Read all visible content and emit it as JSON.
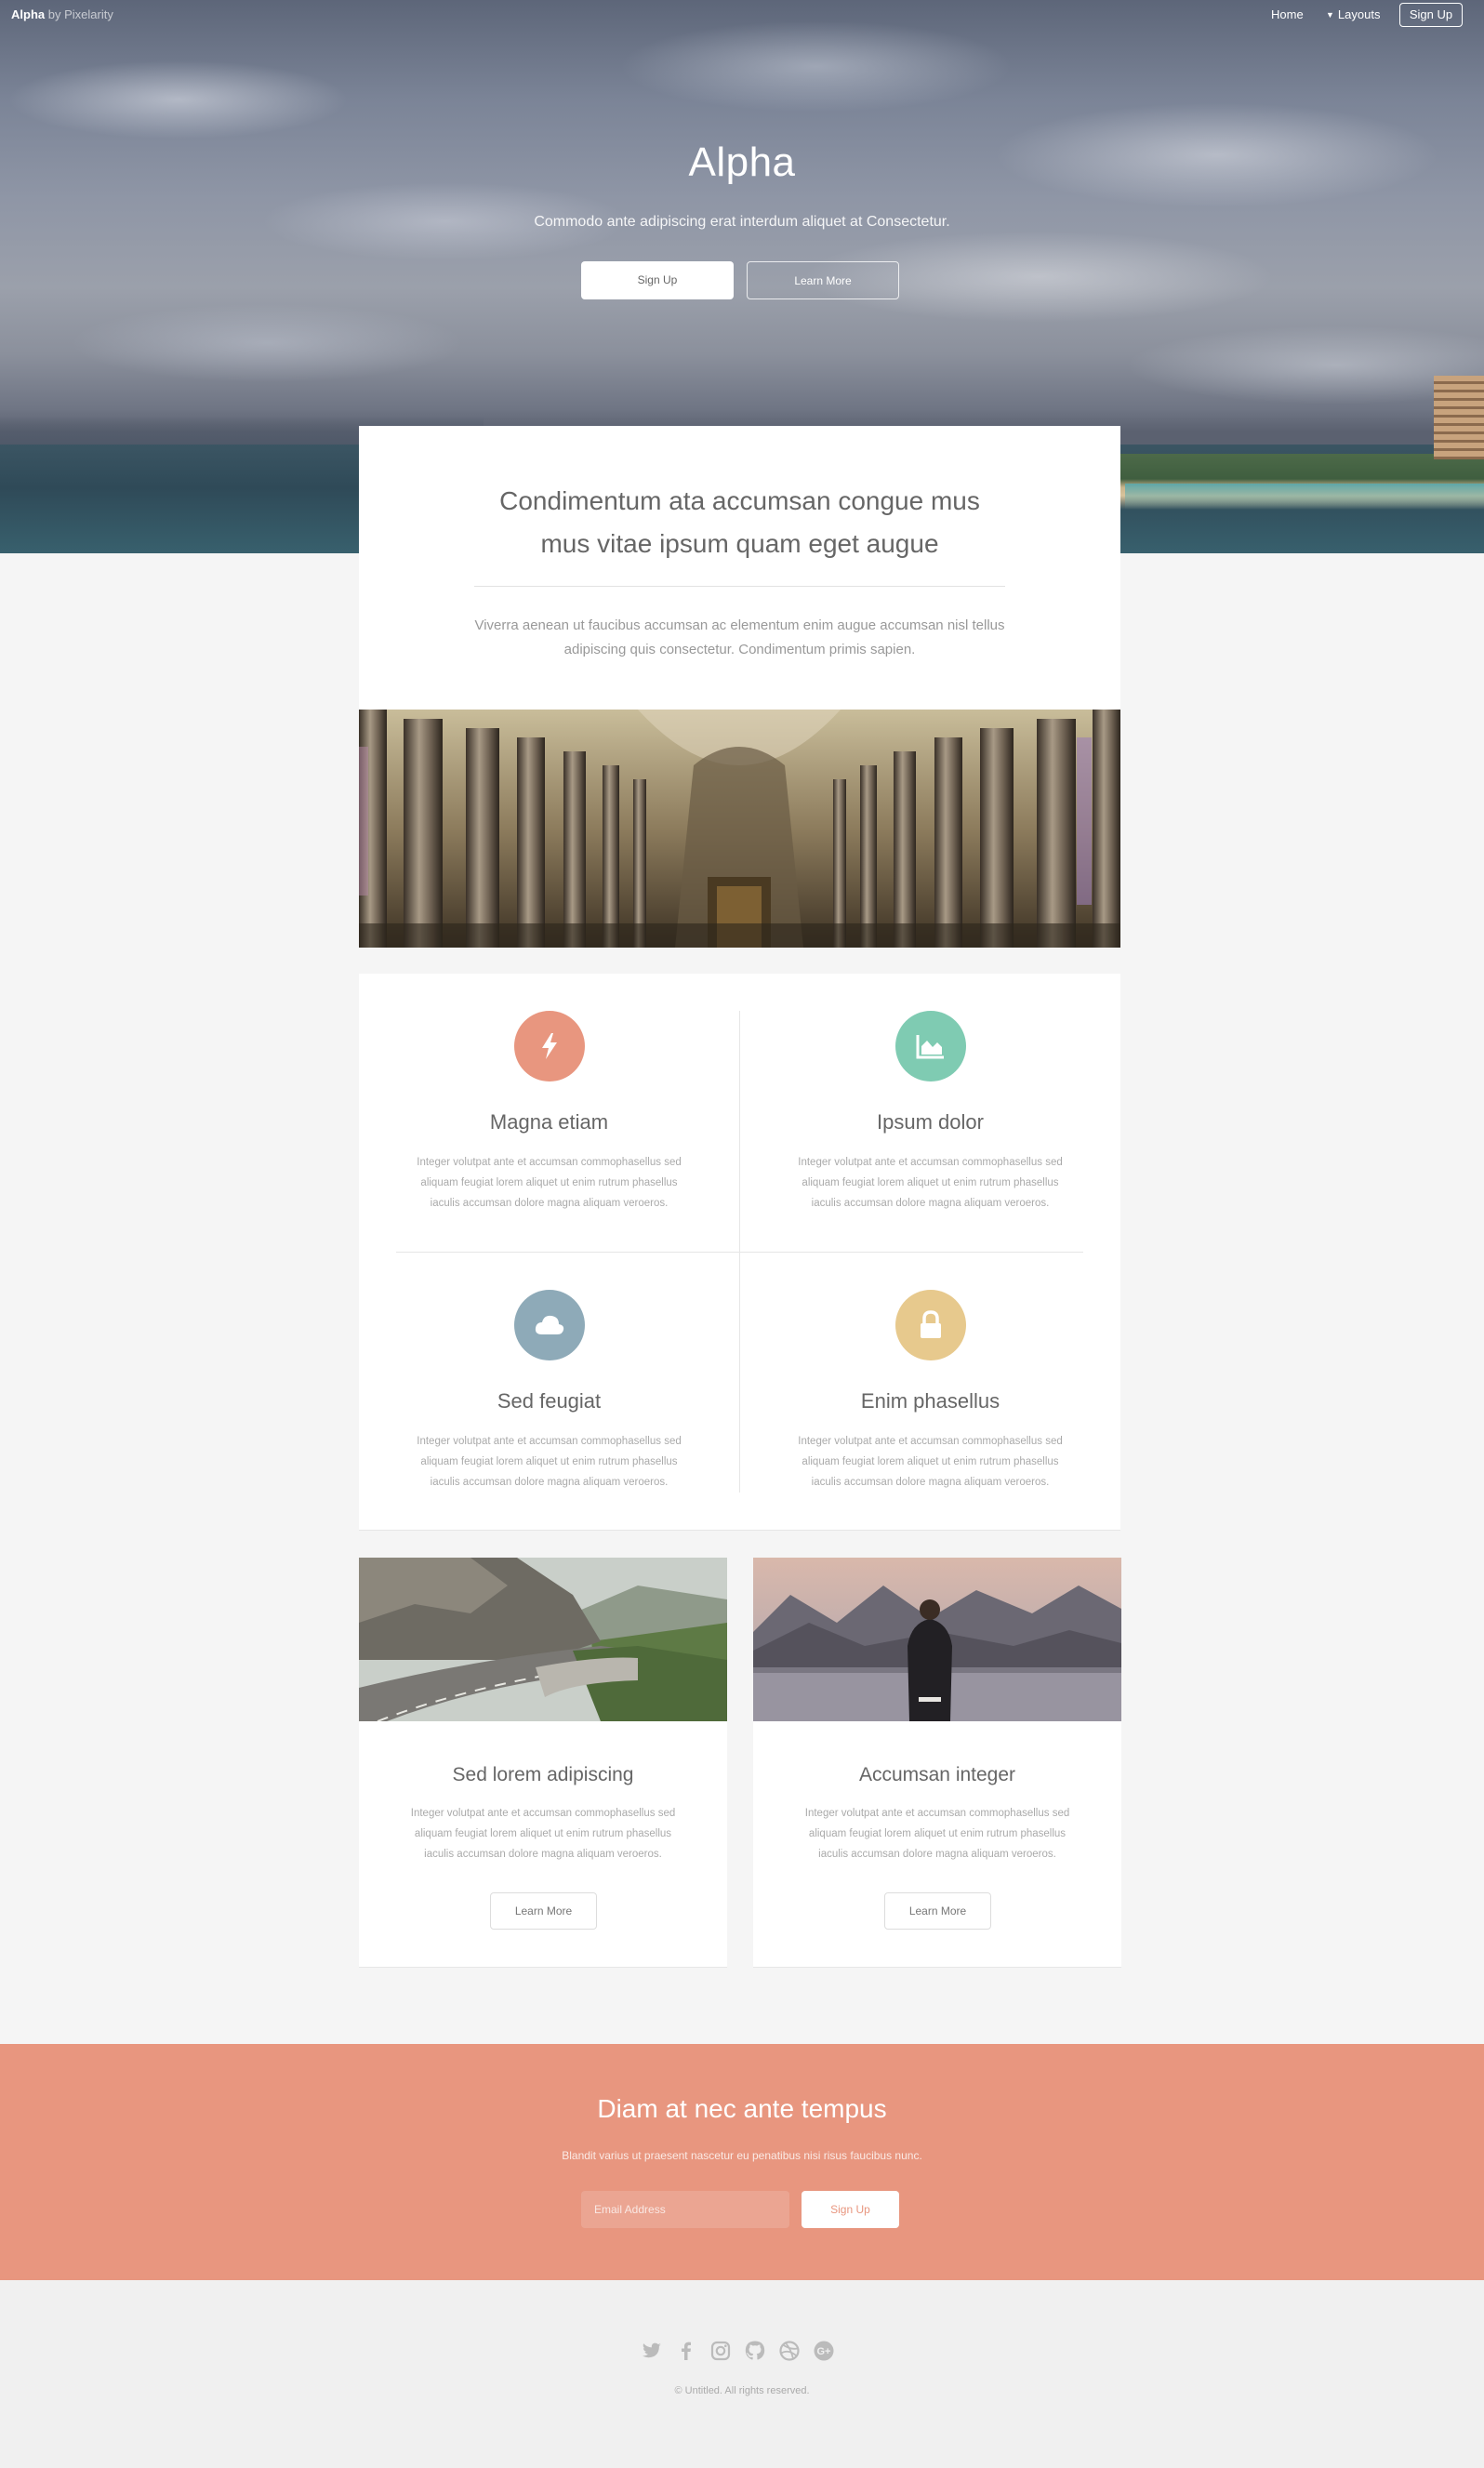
{
  "nav": {
    "brand_name": "Alpha",
    "brand_suffix": "by Pixelarity",
    "links": [
      "Home",
      "Layouts"
    ],
    "signup_label": "Sign Up"
  },
  "hero": {
    "title": "Alpha",
    "subtitle": "Commodo ante adipiscing erat interdum aliquet at Consectetur.",
    "primary_button": "Sign Up",
    "secondary_button": "Learn More"
  },
  "intro": {
    "headline_line1": "Condimentum ata accumsan congue mus",
    "headline_line2": "mus vitae ipsum quam eget augue",
    "text": "Viverra aenean ut faucibus accumsan ac elementum enim augue accumsan nisl tellus adipiscing quis consectetur. Condimentum primis sapien."
  },
  "features": [
    {
      "title": "Magna etiam",
      "icon": "bolt-icon",
      "color": "#e8967f",
      "text": "Integer volutpat ante et accumsan commophasellus sed aliquam feugiat lorem aliquet ut enim rutrum phasellus iaculis accumsan dolore magna aliquam veroeros."
    },
    {
      "title": "Ipsum dolor",
      "icon": "area-chart-icon",
      "color": "#7fcbb2",
      "text": "Integer volutpat ante et accumsan commophasellus sed aliquam feugiat lorem aliquet ut enim rutrum phasellus iaculis accumsan dolore magna aliquam veroeros."
    },
    {
      "title": "Sed feugiat",
      "icon": "cloud-icon",
      "color": "#8eaab8",
      "text": "Integer volutpat ante et accumsan commophasellus sed aliquam feugiat lorem aliquet ut enim rutrum phasellus iaculis accumsan dolore magna aliquam veroeros."
    },
    {
      "title": "Enim phasellus",
      "icon": "lock-icon",
      "color": "#e7c98d",
      "text": "Integer volutpat ante et accumsan commophasellus sed aliquam feugiat lorem aliquet ut enim rutrum phasellus iaculis accumsan dolore magna aliquam veroeros."
    }
  ],
  "boxes": [
    {
      "title": "Sed lorem adipiscing",
      "text": "Integer volutpat ante et accumsan commophasellus sed aliquam feugiat lorem aliquet ut enim rutrum phasellus iaculis accumsan dolore magna aliquam veroeros.",
      "button": "Learn More"
    },
    {
      "title": "Accumsan integer",
      "text": "Integer volutpat ante et accumsan commophasellus sed aliquam feugiat lorem aliquet ut enim rutrum phasellus iaculis accumsan dolore magna aliquam veroeros.",
      "button": "Learn More"
    }
  ],
  "cta": {
    "title": "Diam at nec ante tempus",
    "subtitle": "Blandit varius ut praesent nascetur eu penatibus nisi risus faucibus nunc.",
    "email_placeholder": "Email Address",
    "button": "Sign Up",
    "color": "#e8967f"
  },
  "footer": {
    "social_icons": [
      "twitter-icon",
      "facebook-icon",
      "instagram-icon",
      "github-icon",
      "dribbble-icon",
      "google-plus-icon"
    ],
    "copyright": "© Untitled. All rights reserved."
  }
}
